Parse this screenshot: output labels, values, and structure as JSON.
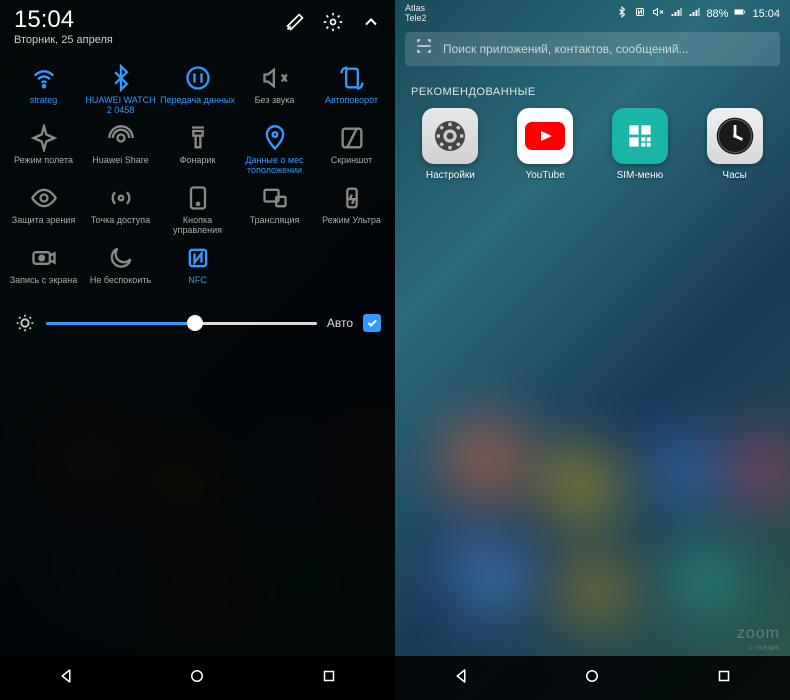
{
  "left": {
    "time": "15:04",
    "date": "Вторник, 25 апреля",
    "tiles": [
      {
        "label": "strateg",
        "active": true
      },
      {
        "label": "HUAWEI WATCH 2 0458",
        "active": true
      },
      {
        "label": "Передача данных",
        "active": true
      },
      {
        "label": "Без звука",
        "active": false
      },
      {
        "label": "Автоповорот",
        "active": true
      },
      {
        "label": "Режим полета",
        "active": false
      },
      {
        "label": "Huawei Share",
        "active": false
      },
      {
        "label": "Фонарик",
        "active": false
      },
      {
        "label": "Данные о мес тоположении",
        "active": true
      },
      {
        "label": "Скриншот",
        "active": false
      },
      {
        "label": "Защита зрения",
        "active": false
      },
      {
        "label": "Точка доступа",
        "active": false
      },
      {
        "label": "Кнопка управления",
        "active": false
      },
      {
        "label": "Трансляция",
        "active": false
      },
      {
        "label": "Режим Ультра",
        "active": false
      },
      {
        "label": "Запись с экрана",
        "active": false
      },
      {
        "label": "Не беспокоить",
        "active": false
      },
      {
        "label": "NFC",
        "active": true
      }
    ],
    "brightness_auto": "Авто"
  },
  "right": {
    "carrier1": "Atlas",
    "carrier2": "Tele2",
    "battery": "88%",
    "time": "15:04",
    "search_placeholder": "Поиск приложений, контактов, сообщений...",
    "recommended": "РЕКОМЕНДОВАННЫЕ",
    "apps": [
      {
        "label": "Настройки"
      },
      {
        "label": "YouTube"
      },
      {
        "label": "SIM-меню"
      },
      {
        "label": "Часы"
      }
    ]
  },
  "watermark": "zoom",
  "watermark_sub": "c-news"
}
